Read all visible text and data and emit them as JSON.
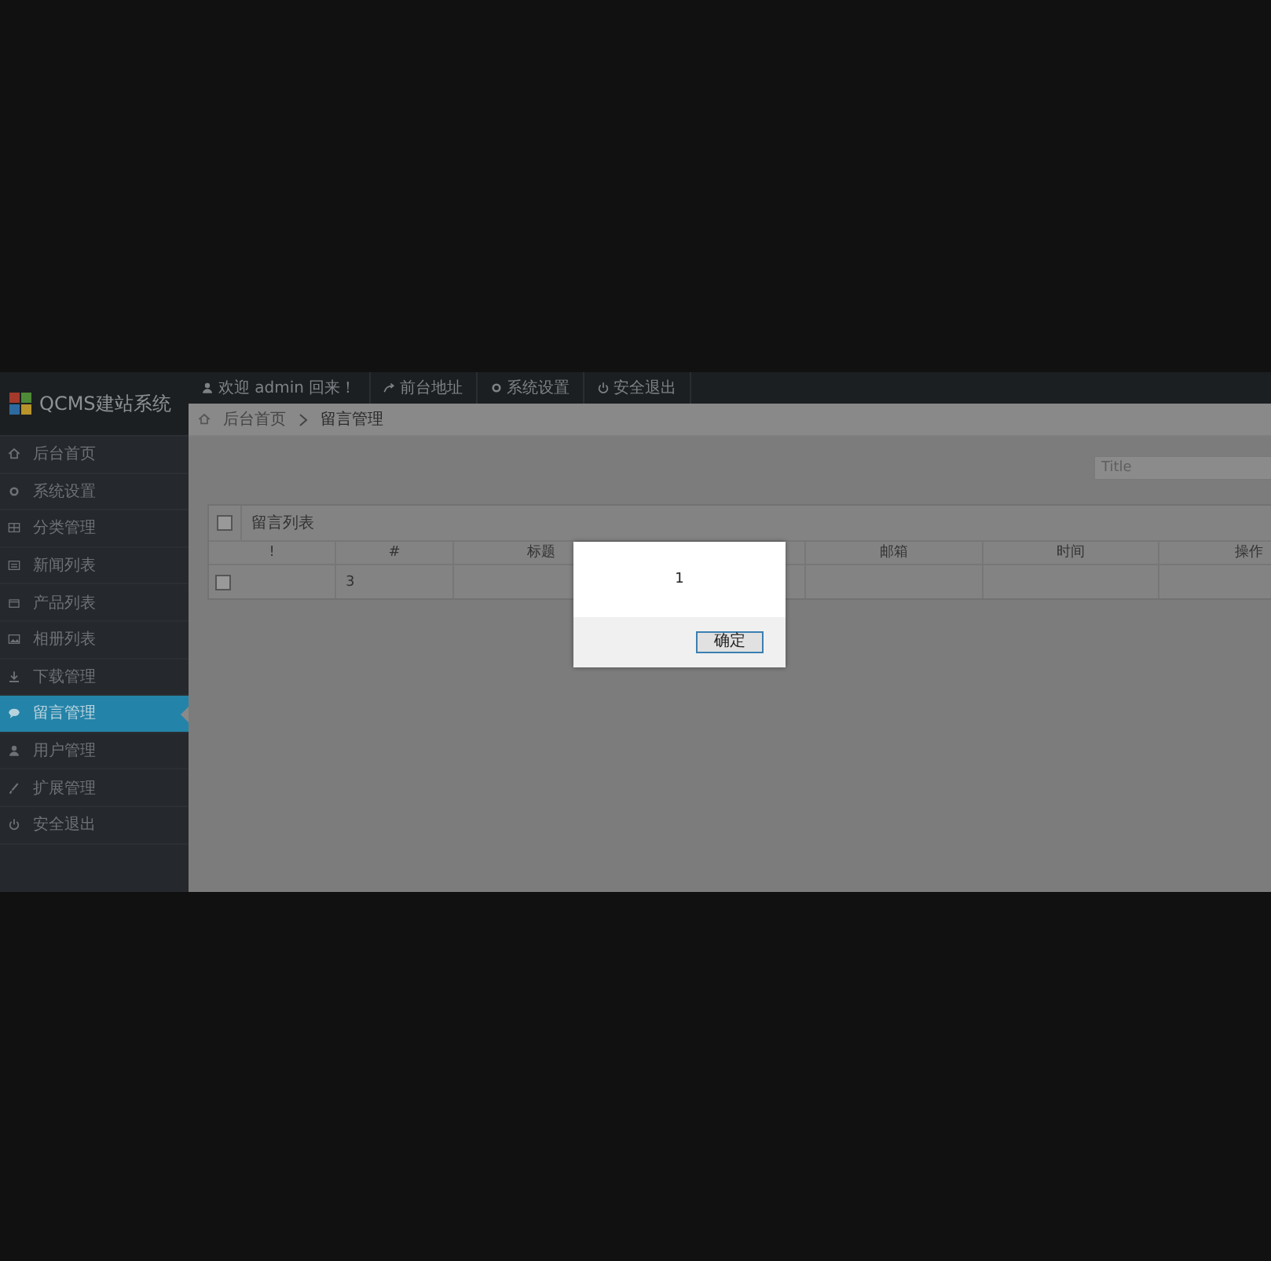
{
  "app": {
    "logo": "QCMS建站系统"
  },
  "top_nav": [
    {
      "kind": "user",
      "label": "欢迎 admin 回来！"
    },
    {
      "kind": "link",
      "label": "前台地址"
    },
    {
      "kind": "settings",
      "label": "系统设置"
    },
    {
      "kind": "logout",
      "label": "安全退出"
    }
  ],
  "sidebar": {
    "items": [
      {
        "kind": "home",
        "label": "后台首页",
        "selected": false
      },
      {
        "kind": "settings",
        "label": "系统设置",
        "selected": false
      },
      {
        "kind": "grid",
        "label": "分类管理",
        "selected": false
      },
      {
        "kind": "list",
        "label": "新闻列表",
        "selected": false
      },
      {
        "kind": "box",
        "label": "产品列表",
        "selected": false
      },
      {
        "kind": "image",
        "label": "相册列表",
        "selected": false
      },
      {
        "kind": "download",
        "label": "下载管理",
        "selected": false
      },
      {
        "kind": "chat",
        "label": "留言管理",
        "selected": true
      },
      {
        "kind": "user",
        "label": "用户管理",
        "selected": false
      },
      {
        "kind": "brush",
        "label": "扩展管理",
        "selected": false
      },
      {
        "kind": "logout",
        "label": "安全退出",
        "selected": false
      }
    ]
  },
  "breadcrumb": [
    "后台首页",
    "留言管理"
  ],
  "search": {
    "placeholder": "Title"
  },
  "table": {
    "title": "留言列表",
    "select_all_checked": false,
    "columns": [
      "!",
      "#",
      "标题",
      "邮箱",
      "时间",
      "操作"
    ],
    "rows": [
      {
        "checked": false,
        "number": "3"
      }
    ]
  },
  "dialog": {
    "message": "1",
    "buttons": [
      "确定"
    ]
  }
}
